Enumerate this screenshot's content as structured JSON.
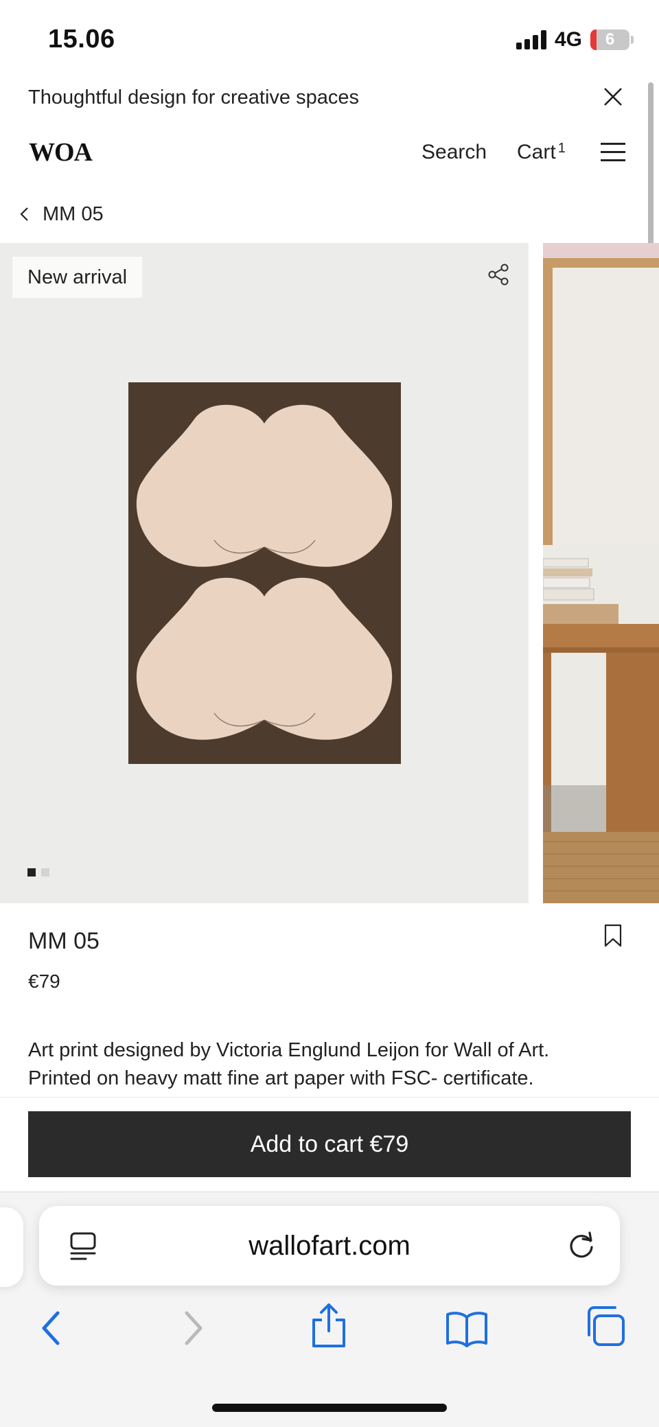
{
  "status_bar": {
    "time": "15.06",
    "network": "4G",
    "battery": "6"
  },
  "announcement": {
    "text": "Thoughtful design for creative spaces"
  },
  "header": {
    "logo": "WOA",
    "search_label": "Search",
    "cart_label": "Cart",
    "cart_count": "1"
  },
  "breadcrumb": {
    "label": "MM 05"
  },
  "gallery": {
    "badge": "New arrival",
    "slide_count": 2,
    "active_slide": 1,
    "poster_bg": "#4d3b2e",
    "shape_color": "#ead3c1"
  },
  "product": {
    "title": "MM 05",
    "price": "€79",
    "description_line1": "Art print designed by Victoria Englund Leijon for Wall of Art.",
    "description_line2": "Printed on heavy matt fine art paper with FSC- certificate."
  },
  "sticky_cart": {
    "button_label": "Add to cart €79"
  },
  "browser": {
    "url": "wallofart.com",
    "accent": "#1f6fe0",
    "toolbar": [
      "back-icon",
      "forward-icon",
      "share-icon",
      "bookmarks-icon",
      "tabs-icon"
    ]
  }
}
